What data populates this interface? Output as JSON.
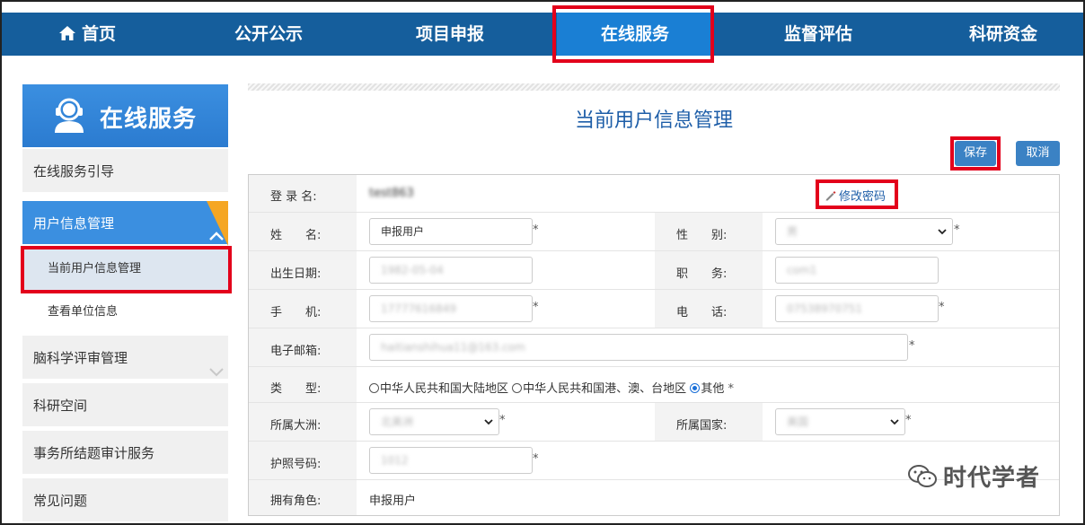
{
  "nav": {
    "home": "首页",
    "items": [
      "公开公示",
      "项目申报",
      "在线服务",
      "监督评估",
      "科研资金"
    ],
    "active_index": 2
  },
  "sidebar": {
    "banner_title": "在线服务",
    "items": [
      {
        "label": "在线服务引导"
      },
      {
        "label": "用户信息管理",
        "active": true
      },
      {
        "label": "当前用户信息管理",
        "sub": true,
        "current": true
      },
      {
        "label": "查看单位信息",
        "sub": true
      },
      {
        "label": "脑科学评审管理"
      },
      {
        "label": "科研空间"
      },
      {
        "label": "事务所结题审计服务"
      },
      {
        "label": "常见问题"
      }
    ]
  },
  "page": {
    "title": "当前用户信息管理",
    "save_label": "保存",
    "cancel_label": "取消",
    "change_password": "修改密码"
  },
  "form": {
    "login_label": "登 录 名:",
    "login_value": "test863",
    "name_label": "姓　　名:",
    "name_value": "申报用户",
    "gender_label": "性　　别:",
    "gender_value": "男",
    "birth_label": "出生日期:",
    "birth_value": "1982-05-04",
    "post_label": "职　　务:",
    "post_value": "com1",
    "mobile_label": "手　　机:",
    "mobile_value": "17777616849",
    "phone_label": "电　　话:",
    "phone_value": "07538970751",
    "email_label": "电子邮箱:",
    "email_value": "haitianshihua11@163.com",
    "type_label": "类　　型:",
    "type_options": [
      "中华人民共和国大陆地区",
      "中华人民共和国港、澳、台地区",
      "其他"
    ],
    "type_selected": 2,
    "continent_label": "所属大洲:",
    "continent_value": "北美洲",
    "country_label": "所属国家:",
    "country_value": "美国",
    "passport_label": "护照号码:",
    "passport_value": "1012",
    "role_label": "拥有角色:",
    "role_value": "申报用户",
    "required_mark": "*"
  },
  "watermark": "时代学者",
  "colors": {
    "nav_bg": "#155e9c",
    "nav_active": "#1a7fd4",
    "highlight_box": "#e3001b",
    "accent": "#3b82c4"
  }
}
